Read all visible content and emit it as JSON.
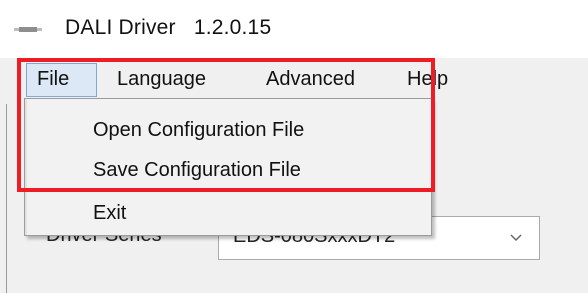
{
  "window": {
    "title": "DALI Driver   1.2.0.15",
    "icon": "app-icon"
  },
  "menubar": {
    "items": [
      {
        "label": "File",
        "state": "open"
      },
      {
        "label": "Language"
      },
      {
        "label": "Advanced"
      },
      {
        "label": "Help"
      }
    ]
  },
  "file_menu": {
    "items": [
      {
        "label": "Open Configuration File"
      },
      {
        "label": "Save Configuration File"
      },
      {
        "label": "Exit"
      }
    ]
  },
  "form": {
    "driver_series_label": "Driver Series",
    "driver_series_value": "EDS-080SxxxDT2"
  },
  "annotation": {
    "color": "#ee1c25"
  }
}
